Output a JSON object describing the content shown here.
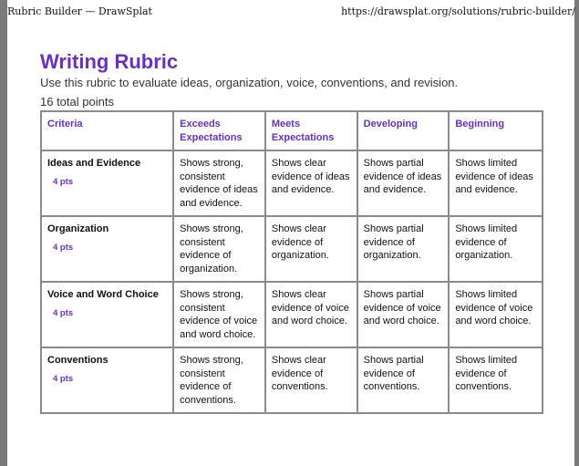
{
  "print_header": {
    "title": "Rubric Builder — DrawSplat",
    "url": "https://drawsplat.org/solutions/rubric-builder/"
  },
  "document": {
    "title": "Writing Rubric",
    "subtitle": "Use this rubric to evaluate ideas, organization, voice, conventions, and revision.",
    "total_points": "16 total points"
  },
  "colors": {
    "accent": "#6b2fc4",
    "border": "#8a8a8a",
    "frame": "#7a7a7a"
  },
  "rubric": {
    "headers": [
      "Criteria",
      "Exceeds Expectations",
      "Meets Expectations",
      "Developing",
      "Beginning"
    ],
    "rows": [
      {
        "criterion": "Ideas and Evidence",
        "points": "4 pts",
        "cells": [
          "Shows strong, consistent evidence of ideas and evidence.",
          "Shows clear evidence of ideas and evidence.",
          "Shows partial evidence of ideas and evidence.",
          "Shows limited evidence of ideas and evidence."
        ]
      },
      {
        "criterion": "Organization",
        "points": "4 pts",
        "cells": [
          "Shows strong, consistent evidence of organization.",
          "Shows clear evidence of organization.",
          "Shows partial evidence of organization.",
          "Shows limited evidence of organization."
        ]
      },
      {
        "criterion": "Voice and Word Choice",
        "points": "4 pts",
        "cells": [
          "Shows strong, consistent evidence of voice and word choice.",
          "Shows clear evidence of voice and word choice.",
          "Shows partial evidence of voice and word choice.",
          "Shows limited evidence of voice and word choice."
        ]
      },
      {
        "criterion": "Conventions",
        "points": "4 pts",
        "cells": [
          "Shows strong, consistent evidence of conventions.",
          "Shows clear evidence of conventions.",
          "Shows partial evidence of conventions.",
          "Shows limited evidence of conventions."
        ]
      }
    ]
  }
}
